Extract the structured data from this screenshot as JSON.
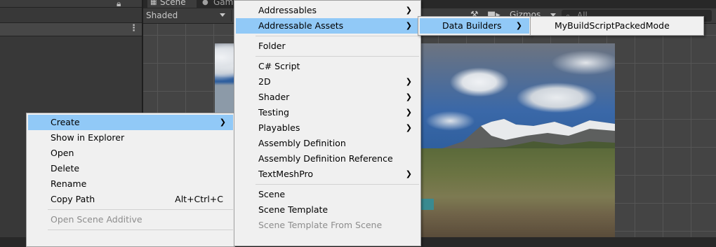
{
  "editor": {
    "tabs": [
      {
        "label": "Scene",
        "icon": "grid-icon"
      },
      {
        "label": "Game",
        "icon": "gamepad-icon"
      }
    ],
    "toolbar": {
      "shading_mode": "Shaded",
      "gizmos_label": "Gizmos",
      "search_placeholder": "All"
    }
  },
  "context_menu": {
    "items": [
      {
        "label": "Create",
        "has_submenu": true,
        "highlighted": true
      },
      {
        "label": "Show in Explorer"
      },
      {
        "label": "Open"
      },
      {
        "label": "Delete"
      },
      {
        "label": "Rename"
      },
      {
        "label": "Copy Path",
        "shortcut": "Alt+Ctrl+C"
      },
      {
        "label": "Open Scene Additive",
        "disabled": true
      }
    ]
  },
  "create_menu": {
    "items": [
      {
        "label": "Addressables",
        "has_submenu": true
      },
      {
        "label": "Addressable Assets",
        "has_submenu": true,
        "highlighted": true
      },
      {
        "label": "Folder"
      },
      {
        "label": "C# Script"
      },
      {
        "label": "2D",
        "has_submenu": true
      },
      {
        "label": "Shader",
        "has_submenu": true
      },
      {
        "label": "Testing",
        "has_submenu": true
      },
      {
        "label": "Playables",
        "has_submenu": true
      },
      {
        "label": "Assembly Definition"
      },
      {
        "label": "Assembly Definition Reference"
      },
      {
        "label": "TextMeshPro",
        "has_submenu": true
      },
      {
        "label": "Scene"
      },
      {
        "label": "Scene Template"
      },
      {
        "label": "Scene Template From Scene",
        "disabled": true
      }
    ]
  },
  "addressable_assets_menu": {
    "items": [
      {
        "label": "Data Builders",
        "has_submenu": true,
        "highlighted": true
      }
    ]
  },
  "data_builders_menu": {
    "items": [
      {
        "label": "MyBuildScriptPackedMode"
      }
    ]
  },
  "colors": {
    "menu_background": "#f0f0f0",
    "menu_highlight": "#91c9f7",
    "editor_background": "#383838"
  }
}
